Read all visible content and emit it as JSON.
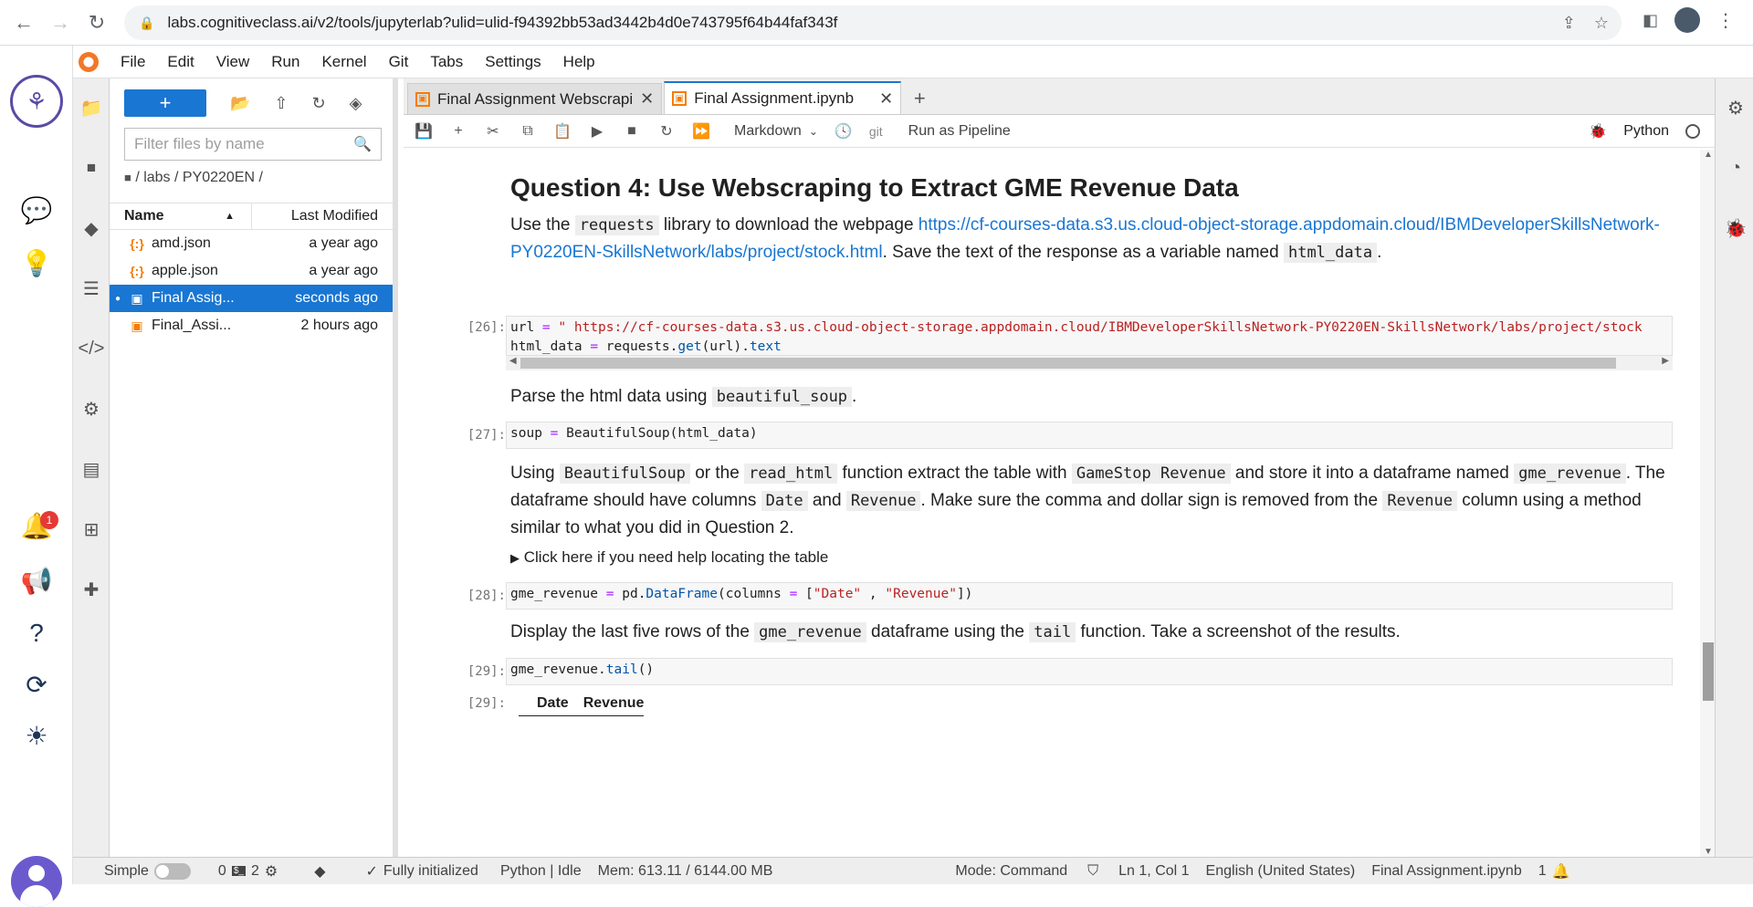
{
  "browser": {
    "url": "labs.cognitiveclass.ai/v2/tools/jupyterlab?ulid=ulid-f94392bb53ad3442b4d0e743795f64b44faf343f"
  },
  "menu": [
    "File",
    "Edit",
    "View",
    "Run",
    "Kernel",
    "Git",
    "Tabs",
    "Settings",
    "Help"
  ],
  "left_rail": {
    "notification_count": "1"
  },
  "filebrowser": {
    "filter_placeholder": "Filter files by name",
    "breadcrumb": "/ labs / PY0220EN /",
    "col_name": "Name",
    "col_modified": "Last Modified",
    "files": [
      {
        "icon": "{:}",
        "name": "amd.json",
        "modified": "a year ago"
      },
      {
        "icon": "{:}",
        "name": "apple.json",
        "modified": "a year ago"
      },
      {
        "icon": "▣",
        "name": "Final Assig...",
        "modified": "seconds ago"
      },
      {
        "icon": "▣",
        "name": "Final_Assi...",
        "modified": "2 hours ago"
      }
    ]
  },
  "tabs": [
    {
      "label": "Final Assignment Webscrapi"
    },
    {
      "label": "Final Assignment.ipynb"
    }
  ],
  "toolbar": {
    "cell_type": "Markdown",
    "git_label": "git",
    "pipeline_label": "Run as Pipeline",
    "kernel_name": "Python"
  },
  "notebook": {
    "heading": "Question 4: Use Webscraping to Extract GME Revenue Data",
    "p1_a": "Use the ",
    "p1_code": "requests",
    "p1_b": " library to download the webpage ",
    "p1_link": "https://cf-courses-data.s3.us.cloud-object-storage.appdomain.cloud/IBMDeveloperSkillsNetwork-PY0220EN-SkillsNetwork/labs/project/stock.html",
    "p1_c": ". Save the text of the response as a variable named ",
    "p1_code2": "html_data",
    "p1_d": ".",
    "cell26_prompt": "[26]:",
    "cell26_line1_a": "url ",
    "cell26_line1_op": "=",
    "cell26_line1_str": " \" https://cf-courses-data.s3.us.cloud-object-storage.appdomain.cloud/IBMDeveloperSkillsNetwork-PY0220EN-SkillsNetwork/labs/project/stock",
    "cell26_line2_a": "html_data ",
    "cell26_line2_op": "=",
    "cell26_line2_b": " requests.",
    "cell26_line2_fn": "get",
    "cell26_line2_c": "(url).",
    "cell26_line2_attr": "text",
    "p2_a": "Parse the html data using ",
    "p2_code": "beautiful_soup",
    "p2_b": ".",
    "cell27_prompt": "[27]:",
    "cell27_a": "soup ",
    "cell27_op": "=",
    "cell27_b": " BeautifulSoup(html_data)",
    "p3_a": "Using ",
    "p3_c1": "BeautifulSoup",
    "p3_b": " or the ",
    "p3_c2": "read_html",
    "p3_c": " function extract the table with ",
    "p3_c3": "GameStop Revenue",
    "p3_d": " and store it into a dataframe named ",
    "p3_c4": "gme_revenue",
    "p3_e": ". The dataframe should have columns ",
    "p3_c5": "Date",
    "p3_f": " and ",
    "p3_c6": "Revenue",
    "p3_g": ". Make sure the comma and dollar sign is removed from the ",
    "p3_c7": "Revenue",
    "p3_h": " column using a method similar to what you did in Question 2.",
    "details": "Click here if you need help locating the table",
    "cell28_prompt": "[28]:",
    "cell28_a": "gme_revenue ",
    "cell28_op": "=",
    "cell28_b": " pd.",
    "cell28_fn": "DataFrame",
    "cell28_c": "(columns ",
    "cell28_op2": "=",
    "cell28_d": " [",
    "cell28_s1": "\"Date\"",
    "cell28_e": " , ",
    "cell28_s2": "\"Revenue\"",
    "cell28_f": "])",
    "p4_a": "Display the last five rows of the ",
    "p4_c1": "gme_revenue",
    "p4_b": " dataframe using the ",
    "p4_c2": "tail",
    "p4_c": " function. Take a screenshot of the results.",
    "cell29_prompt": "[29]:",
    "cell29_a": "gme_revenue.",
    "cell29_fn": "tail",
    "cell29_b": "()",
    "out29_prompt": "[29]:",
    "out29_col1": "Date",
    "out29_col2": "Revenue"
  },
  "statusbar": {
    "mode_simple": "Simple",
    "count_a": "0",
    "count_b": "2",
    "init": "Fully initialized",
    "kernel": "Python | Idle",
    "mem": "Mem: 613.11 / 6144.00 MB",
    "mode": "Mode: Command",
    "cursor": "Ln 1, Col 1",
    "lang": "English (United States)",
    "file": "Final Assignment.ipynb",
    "notif": "1"
  }
}
